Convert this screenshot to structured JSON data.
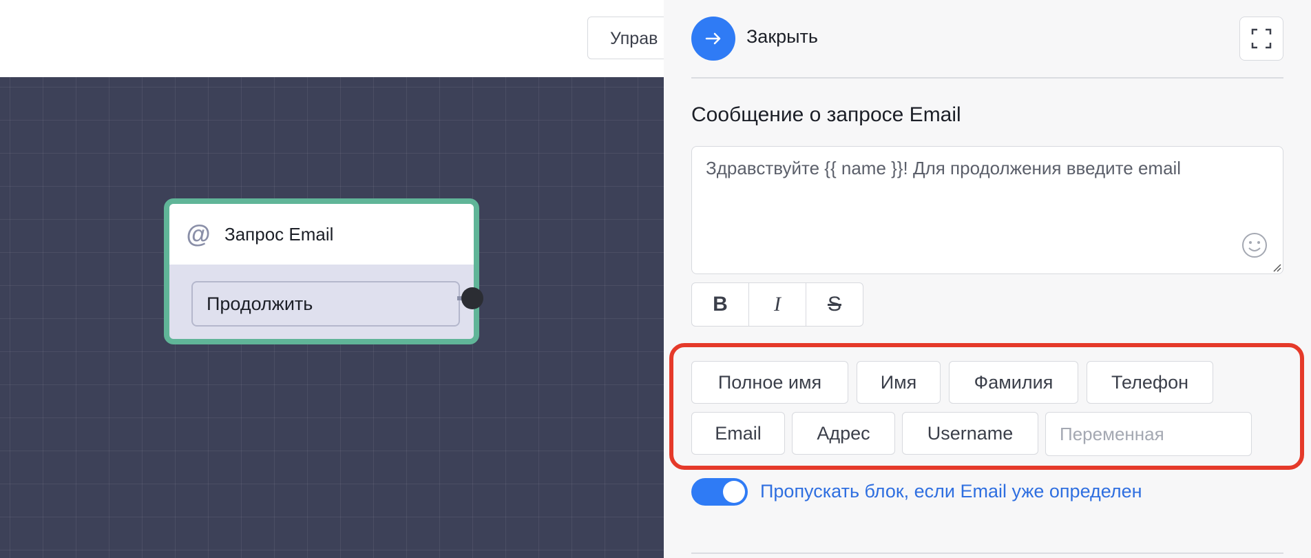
{
  "topbar": {
    "manage_label": "Управ"
  },
  "node": {
    "title": "Запрос Email",
    "button_label": "Продолжить"
  },
  "panel": {
    "close_label": "Закрыть",
    "section_title": "Сообщение о запросе Email",
    "message_text": "Здравствуйте {{ name }}! Для продолжения введите email",
    "format_buttons": [
      "B",
      "I",
      "S"
    ],
    "variable_chips": [
      "Полное имя",
      "Имя",
      "Фамилия",
      "Телефон",
      "Email",
      "Адрес",
      "Username"
    ],
    "variable_placeholder": "Переменная",
    "skip_toggle_label": "Пропускать блок, если Email уже определен",
    "skip_toggle_on": true
  },
  "colors": {
    "accent": "#2f7bf5",
    "node_border": "#60b598",
    "canvas": "#3d4158",
    "highlight": "#e53a2a"
  }
}
